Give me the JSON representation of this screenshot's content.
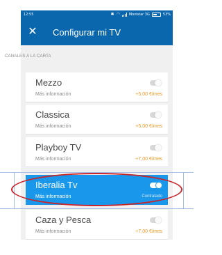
{
  "statusbar": {
    "time": "12:55",
    "carrier": "Movistar 3G",
    "battery": "53%"
  },
  "header": {
    "close_icon": "close-icon",
    "close_glyph": "✕",
    "title": "Configurar mi TV"
  },
  "section": {
    "label": "CANALES A LA CARTA"
  },
  "channels": [
    {
      "name": "Mezzo",
      "info": "Más información",
      "price": "+5,00 €/mes",
      "enabled": false
    },
    {
      "name": "Classica",
      "info": "Más información",
      "price": "+5,00 €/mes",
      "enabled": false
    },
    {
      "name": "Playboy TV",
      "info": "Más información",
      "price": "+7,00 €/mes",
      "enabled": false
    },
    {
      "name": "Iberalia Tv",
      "info": "Más información",
      "price": "Contratado",
      "enabled": true
    },
    {
      "name": "Caza y Pesca",
      "info": "Más información",
      "price": "+7,00 €/mes",
      "enabled": false
    }
  ],
  "colors": {
    "header_blue": "#0a67ad",
    "active_blue": "#1997ea",
    "price_orange": "#f2961e",
    "highlight_red": "#c8242a"
  }
}
